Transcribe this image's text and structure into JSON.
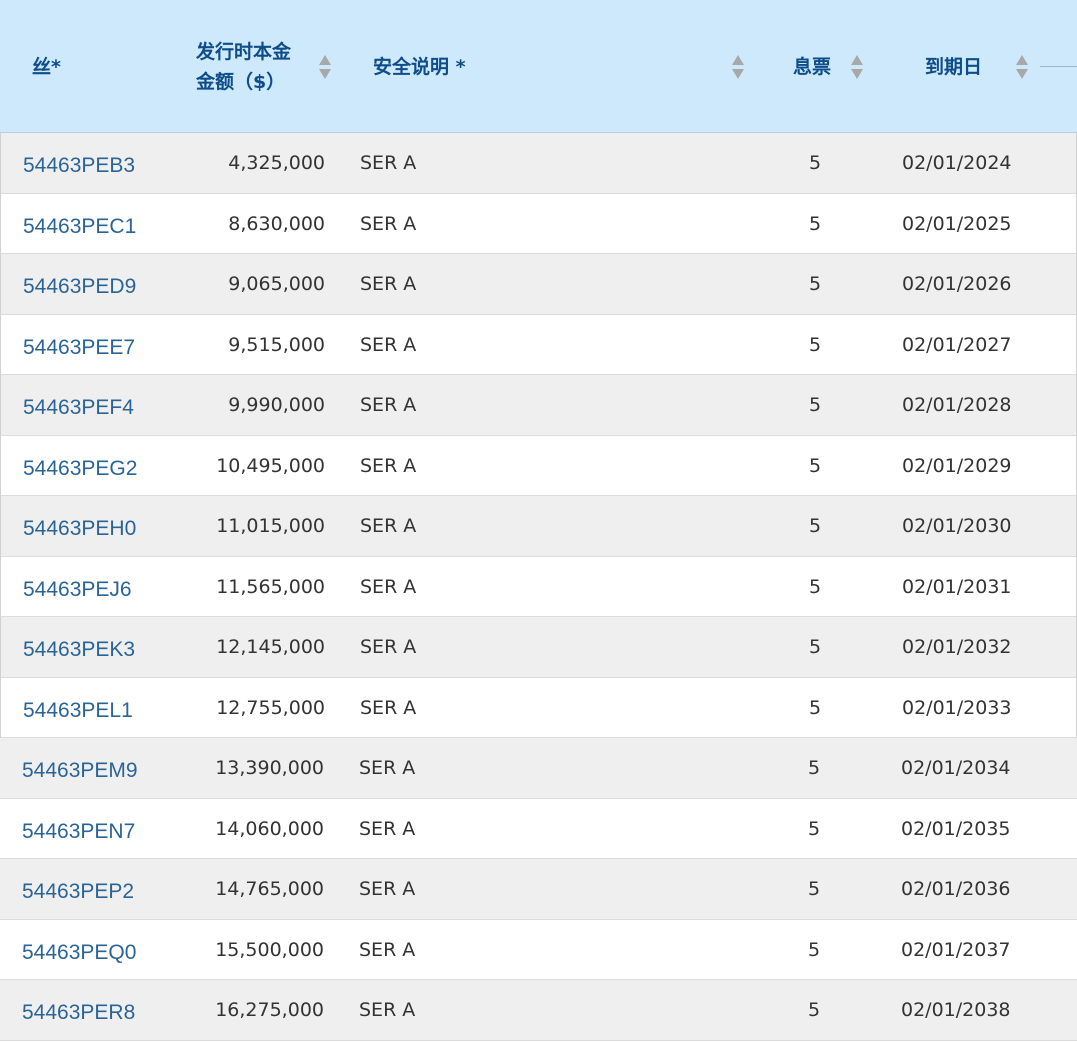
{
  "table": {
    "headers": {
      "cusip": "丝*",
      "amount_line1": "发行时本金",
      "amount_line2": "金额（$）",
      "description": "安全说明 *",
      "coupon": "息票",
      "maturity": "到期日"
    },
    "rows": [
      {
        "cusip": "54463PEB3",
        "amount": "4,325,000",
        "description": "SER A",
        "coupon": "5",
        "maturity": "02/01/2024"
      },
      {
        "cusip": "54463PEC1",
        "amount": "8,630,000",
        "description": "SER A",
        "coupon": "5",
        "maturity": "02/01/2025"
      },
      {
        "cusip": "54463PED9",
        "amount": "9,065,000",
        "description": "SER A",
        "coupon": "5",
        "maturity": "02/01/2026"
      },
      {
        "cusip": "54463PEE7",
        "amount": "9,515,000",
        "description": "SER A",
        "coupon": "5",
        "maturity": "02/01/2027"
      },
      {
        "cusip": "54463PEF4",
        "amount": "9,990,000",
        "description": "SER A",
        "coupon": "5",
        "maturity": "02/01/2028"
      },
      {
        "cusip": "54463PEG2",
        "amount": "10,495,000",
        "description": "SER A",
        "coupon": "5",
        "maturity": "02/01/2029"
      },
      {
        "cusip": "54463PEH0",
        "amount": "11,015,000",
        "description": "SER A",
        "coupon": "5",
        "maturity": "02/01/2030"
      },
      {
        "cusip": "54463PEJ6",
        "amount": "11,565,000",
        "description": "SER A",
        "coupon": "5",
        "maturity": "02/01/2031"
      },
      {
        "cusip": "54463PEK3",
        "amount": "12,145,000",
        "description": "SER A",
        "coupon": "5",
        "maturity": "02/01/2032"
      },
      {
        "cusip": "54463PEL1",
        "amount": "12,755,000",
        "description": "SER A",
        "coupon": "5",
        "maturity": "02/01/2033"
      },
      {
        "cusip": "54463PEM9",
        "amount": "13,390,000",
        "description": "SER A",
        "coupon": "5",
        "maturity": "02/01/2034"
      },
      {
        "cusip": "54463PEN7",
        "amount": "14,060,000",
        "description": "SER A",
        "coupon": "5",
        "maturity": "02/01/2035"
      },
      {
        "cusip": "54463PEP2",
        "amount": "14,765,000",
        "description": "SER A",
        "coupon": "5",
        "maturity": "02/01/2036"
      },
      {
        "cusip": "54463PEQ0",
        "amount": "15,500,000",
        "description": "SER A",
        "coupon": "5",
        "maturity": "02/01/2037"
      },
      {
        "cusip": "54463PER8",
        "amount": "16,275,000",
        "description": "SER A",
        "coupon": "5",
        "maturity": "02/01/2038"
      }
    ]
  },
  "icons": {
    "sort": "sort-up-down-icon"
  },
  "colors": {
    "header_bg": "#cde9fb",
    "header_text": "#0f4c8a",
    "link": "#2a6496",
    "alt_row": "#efefef"
  }
}
